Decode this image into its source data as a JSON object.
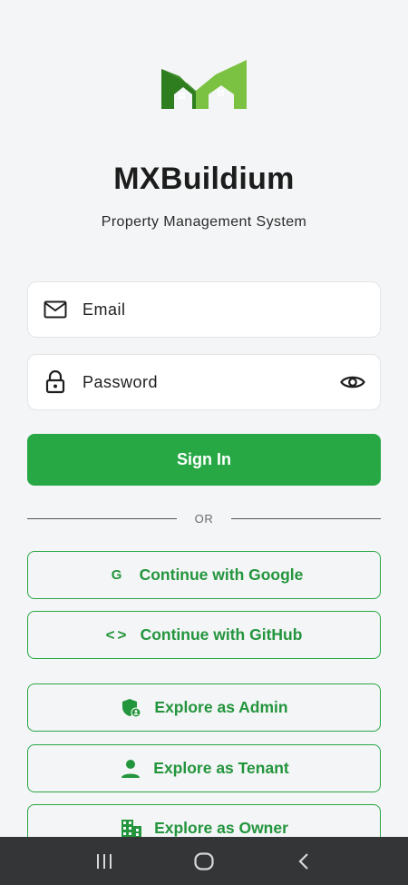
{
  "app": {
    "title": "MXBuildium",
    "subtitle": "Property Management System"
  },
  "login": {
    "email_placeholder": "Email",
    "password_placeholder": "Password",
    "sign_in_label": "Sign In",
    "divider_text": "OR"
  },
  "auth_buttons": {
    "google_glyph": "G",
    "google_label": "Continue with Google",
    "github_glyph": "<>",
    "github_label": "Continue with GitHub"
  },
  "explore_buttons": {
    "admin_label": "Explore as Admin",
    "tenant_label": "Explore as Tenant",
    "owner_label": "Explore as Owner"
  },
  "icons": {
    "email": "mail-icon",
    "password": "lock-icon",
    "toggle": "eye-icon",
    "admin": "shield-user-icon",
    "tenant": "person-icon",
    "owner": "building-icon",
    "nav_recent": "recent-apps-icon",
    "nav_home": "home-icon",
    "nav_back": "back-icon"
  },
  "colors": {
    "brand_green": "#27a845",
    "logo_dark_green": "#2e7d1f",
    "logo_light_green": "#7cc242",
    "background": "#f4f5f6",
    "nav_bar": "#343536"
  }
}
